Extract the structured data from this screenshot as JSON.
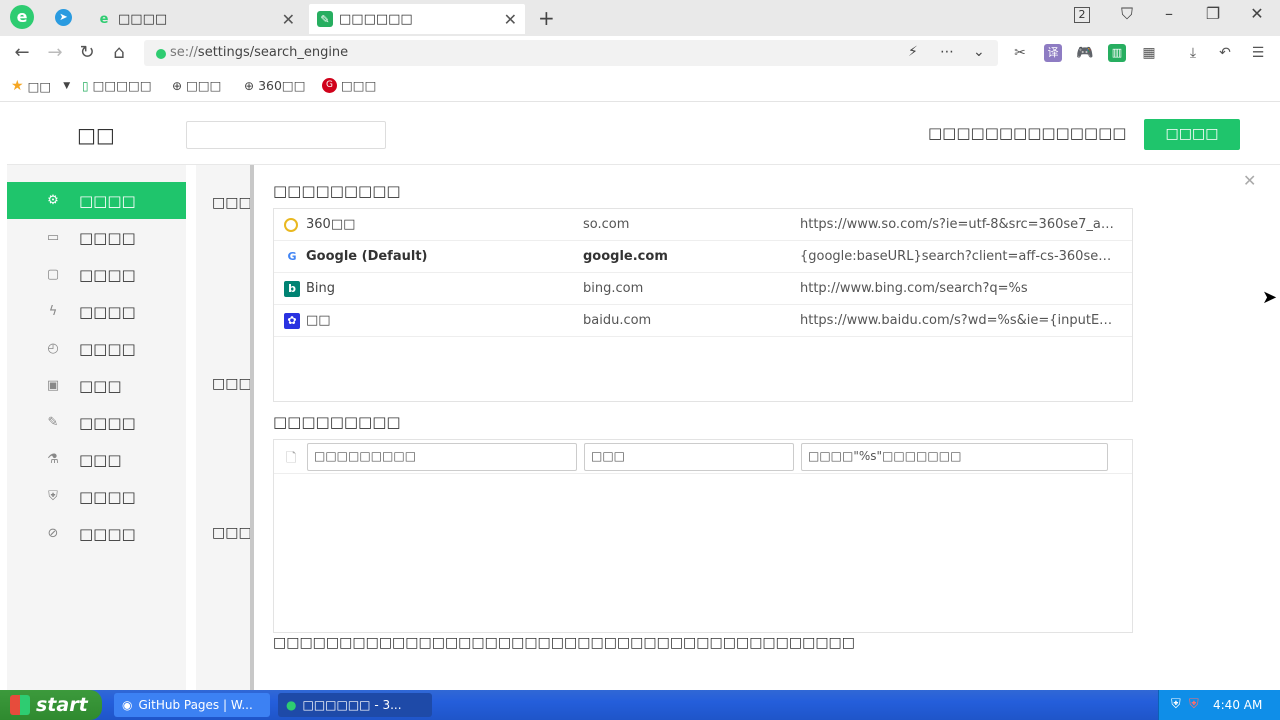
{
  "browser": {
    "tabs": [
      {
        "label": "□□□□"
      },
      {
        "label": "□□□□□□"
      }
    ],
    "tab_count": "2",
    "url_prefix": "se://",
    "url_path": "settings/search_engine"
  },
  "bookmarks": [
    {
      "label": "□□"
    },
    {
      "label": "□□□□□"
    },
    {
      "label": "□□□"
    },
    {
      "label": "360□□"
    },
    {
      "label": "□□□"
    }
  ],
  "settings": {
    "title": "□□",
    "header_note": "□□□□□□□□□□□□□□",
    "header_button": "□□□□",
    "sidebar": [
      {
        "label": "□□□□",
        "icon": "gear-icon"
      },
      {
        "label": "□□□□",
        "icon": "window-icon"
      },
      {
        "label": "□□□□",
        "icon": "monitor-icon"
      },
      {
        "label": "□□□□",
        "icon": "lightning-icon"
      },
      {
        "label": "□□□□",
        "icon": "mouse-icon"
      },
      {
        "label": "□□□",
        "icon": "image-icon"
      },
      {
        "label": "□□□□",
        "icon": "wrench-icon"
      },
      {
        "label": "□□□",
        "icon": "flask-icon"
      },
      {
        "label": "□□□□",
        "icon": "shield-icon"
      },
      {
        "label": "□□□□",
        "icon": "block-icon"
      }
    ],
    "strip_labels": [
      "□□□",
      "□□□",
      "□□□"
    ]
  },
  "dialog": {
    "default_section_title": "□□□□□□□□□",
    "other_section_title": "□□□□□□□□□",
    "engines": [
      {
        "name": "360□□",
        "keyword": "so.com",
        "url": "https://www.so.com/s?ie=utf-8&src=360se7_addr...",
        "icon": "360-search-icon"
      },
      {
        "name": "Google (Default)",
        "keyword": "google.com",
        "url": "{google:baseURL}search?client=aff-cs-360se&ie={i...",
        "icon": "google-icon"
      },
      {
        "name": "Bing",
        "keyword": "bing.com",
        "url": "http://www.bing.com/search?q=%s",
        "icon": "bing-icon"
      },
      {
        "name": "□□",
        "keyword": "baidu.com",
        "url": "https://www.baidu.com/s?wd=%s&ie={inputEncodi...",
        "icon": "baidu-icon"
      }
    ],
    "add_name_placeholder": "□□□□□□□□□",
    "add_keyword_placeholder": "□□□",
    "add_url_placeholder": "□□□□\"%s\"□□□□□□□",
    "footnote": "□□□□□□□□□□□□□□□□□□□□□□□□□□□□□□□□□□□□□□□□□□□□"
  },
  "taskbar": {
    "start_label": "start",
    "tasks": [
      {
        "label": "GitHub Pages | W..."
      },
      {
        "label": "□□□□□□ - 3..."
      }
    ],
    "clock": "4:40 AM"
  },
  "colors": {
    "accent": "#1fc56c",
    "taskbar": "#245edb"
  }
}
